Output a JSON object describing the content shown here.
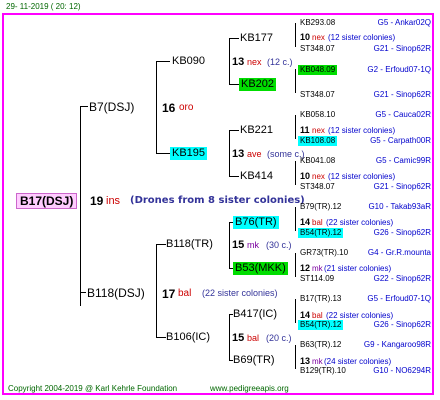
{
  "header": {
    "date": "29- 11-2019 ( 20: 12)"
  },
  "footer": {
    "copyright": "Copyright 2004-2019 @ Karl Kehrle Foundation",
    "site": "www.pedigreeapis.org"
  },
  "root": {
    "id": "B17(DSJ)",
    "num": "19",
    "ins": "ins",
    "note": "(Drones from 8 sister colonies)"
  },
  "gen1": {
    "sire": {
      "id": "B7(DSJ)",
      "num": "16",
      "suffix": "oro"
    },
    "dam": {
      "id": "B118(DSJ)",
      "num": "17",
      "suffix": "bal",
      "note": "(22 sister colonies)"
    }
  },
  "gen2": {
    "s_s": {
      "id": "KB090",
      "num": "13",
      "suffix": "nex",
      "note": "(12 c.)"
    },
    "s_d": {
      "id": "KB195",
      "num": "13",
      "suffix": "ave",
      "note": "(some c.)"
    },
    "d_s": {
      "id": "B118(TR)",
      "num": "15",
      "suffix": "mk",
      "note": "(30 c.)"
    },
    "d_d": {
      "id": "B106(IC)",
      "num": "15",
      "suffix": "bal",
      "note": "(20 c.)"
    }
  },
  "gen3": [
    {
      "id": "KB177",
      "num": "10",
      "suffix": "nex",
      "note": "(12 sister colonies)"
    },
    {
      "id": "KB202"
    },
    {
      "id": "KB221",
      "num": "11",
      "suffix": "nex",
      "note": "(12 sister colonies)"
    },
    {
      "id": "KB414",
      "num": "10",
      "suffix": "nex",
      "note": "(12 sister colonies)"
    },
    {
      "id": "B76(TR)",
      "num": "14",
      "suffix": "bal",
      "note": "(22 sister colonies)"
    },
    {
      "id": "B53(MKK)",
      "num": "12",
      "suffix": "mk",
      "note": "(21 sister colonies)"
    },
    {
      "id": "B417(IC)",
      "num": "14",
      "suffix": "bal",
      "note": "(22 sister colonies)"
    },
    {
      "id": "B69(TR)",
      "num": "13",
      "suffix": "mk",
      "note": "(24 sister colonies)"
    }
  ],
  "gen4": [
    {
      "id": "KB293.08",
      "code": "G5 - Ankar02Q"
    },
    {
      "id": "ST348.07",
      "code": "G21 - Sinop62R"
    },
    {
      "id": "KB048.09",
      "code": "G2 - Erfoud07-1Q"
    },
    {
      "id": "ST348.07",
      "code": "G21 - Sinop62R"
    },
    {
      "id": "KB058.10",
      "code": "G5 - Cauca02R"
    },
    {
      "id": "KB108.08",
      "code": "G5 - Carpath00R"
    },
    {
      "id": "KB041.08",
      "code": "G5 - Camic99R"
    },
    {
      "id": "ST348.07",
      "code": "G21 - Sinop62R"
    },
    {
      "id": "B79(TR).12",
      "code": "G10 - Takab93aR"
    },
    {
      "id": "B54(TR).12",
      "code": "G26 - Sinop62R"
    },
    {
      "id": "GR73(TR).10",
      "code": "G4 - Gr.R.mounta"
    },
    {
      "id": "ST114.09",
      "code": "G22 - Sinop62R"
    },
    {
      "id": "B17(TR).13",
      "code": "G5 - Erfoud07-1Q"
    },
    {
      "id": "B54(TR).12",
      "code": "G26 - Sinop62R"
    },
    {
      "id": "B63(TR).12",
      "code": "G9 - Kangaroo98R"
    },
    {
      "id": "B129(TR).10",
      "code": "G10 - NO6294R"
    }
  ]
}
